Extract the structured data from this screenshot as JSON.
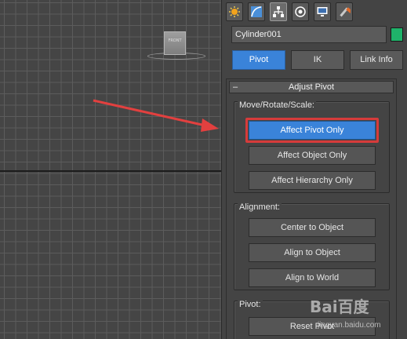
{
  "viewport": {
    "viewcube_label": "FRONT"
  },
  "command_panel": {
    "tabs": [
      {
        "icon": "sun-create-icon"
      },
      {
        "icon": "curve-modify-icon"
      },
      {
        "icon": "hierarchy-icon",
        "active": true
      },
      {
        "icon": "motion-icon"
      },
      {
        "icon": "display-monitor-icon"
      },
      {
        "icon": "hammer-utilities-icon"
      }
    ],
    "object_name": "Cylinder001",
    "object_color": "#1fb36a",
    "hierarchy_buttons": {
      "pivot": "Pivot",
      "ik": "IK",
      "link_info": "Link Info"
    },
    "rollout": {
      "toggle": "–",
      "title": "Adjust Pivot",
      "move_rotate_scale": {
        "label": "Move/Rotate/Scale:",
        "affect_pivot_only": "Affect Pivot Only",
        "affect_object_only": "Affect Object Only",
        "affect_hierarchy_only": "Affect Hierarchy Only"
      },
      "alignment": {
        "label": "Alignment:",
        "center_to_object": "Center to Object",
        "align_to_object": "Align to Object",
        "align_to_world": "Align to World"
      },
      "pivot": {
        "label": "Pivot:",
        "reset_pivot": "Reset Pivot"
      }
    }
  },
  "watermark": {
    "main": "Bai百度",
    "sub": "jingyan.baidu.com"
  },
  "colors": {
    "accent_blue": "#3a83d9",
    "highlight_red": "#d63b3b"
  }
}
